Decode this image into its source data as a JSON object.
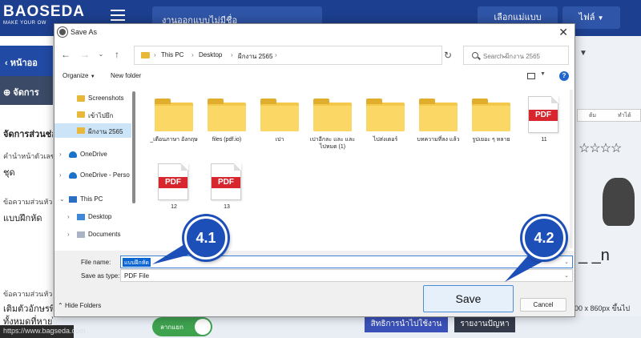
{
  "app": {
    "brand": "BAOSEDA",
    "tagline": "MAKE YOUR OW",
    "project_name": "งานออกแบบไม่มีชื่อ",
    "template_button": "เลือกแม่แบบ",
    "file_menu": "ไฟล์",
    "website": "https://www.bagseda.com"
  },
  "sidebar": {
    "back_label": "หน้าออ",
    "manage_label": "จัดการ",
    "section_label": "จัดการส่วนช่อ",
    "field1_label": "คำนำหน้าตัวเลข",
    "field1_value": "ชุด",
    "field2_label": "ข้อความส่วนหัว (1",
    "field2_value": "แบบฝึกหัด",
    "field3_label": "ข้อความส่วนหัว (2",
    "field3_value_line1": "เติมตัวอักษรพิ",
    "field3_value_line2": "ทั้งหมดที่หายไป"
  },
  "background": {
    "toggle_label": "ลากแยก",
    "rights_button": "สิทธิการนำไปใช้งาน",
    "report_button": "รายงานปัญหา",
    "col_head_1": "ต้ม",
    "col_head_2": "ทำได้",
    "stars": "☆☆☆☆",
    "blank_text": "_ _n",
    "size_note": "600 x 860px ขึ้นไป"
  },
  "dialog": {
    "title": "Save As",
    "breadcrumb": [
      "This PC",
      "Desktop",
      "ผีกงาน 2565"
    ],
    "search_placeholder": "Search ผีกงาน 2565",
    "organize": "Organize",
    "new_folder": "New folder",
    "help": "?",
    "nav_items": [
      {
        "label": "Screenshots",
        "icon": "folder-icon",
        "selected": false,
        "chevron": ""
      },
      {
        "label": "เข้าไปยึก",
        "icon": "folder-icon",
        "selected": false,
        "chevron": ""
      },
      {
        "label": "ผีกงาน 2565",
        "icon": "folder-icon",
        "selected": true,
        "chevron": ""
      },
      {
        "label": "OneDrive",
        "icon": "cloud-icon",
        "selected": false,
        "chevron": ">"
      },
      {
        "label": "OneDrive - Perso",
        "icon": "cloud-icon",
        "selected": false,
        "chevron": ">"
      },
      {
        "label": "This PC",
        "icon": "computer-icon",
        "selected": false,
        "chevron": "v"
      },
      {
        "label": "Desktop",
        "icon": "desktop-icon",
        "selected": false,
        "chevron": ">"
      },
      {
        "label": "Documents",
        "icon": "documents-icon",
        "selected": false,
        "chevron": ">"
      }
    ],
    "files": [
      {
        "name": "_เตือนภาษา อังกฤษ",
        "type": "folder"
      },
      {
        "name": "files (pdf.io)",
        "type": "folder"
      },
      {
        "name": "เปา",
        "type": "folder"
      },
      {
        "name": "เปาอีกละ และ และไปหมด (1)",
        "type": "folder"
      },
      {
        "name": "ไปส่งเตอร์",
        "type": "folder"
      },
      {
        "name": "บทความที่ลง แล้ว",
        "type": "folder"
      },
      {
        "name": "รูปเยอะ ๆ หลาย",
        "type": "folder"
      },
      {
        "name": "11",
        "type": "pdf"
      },
      {
        "name": "12",
        "type": "pdf"
      },
      {
        "name": "13",
        "type": "pdf"
      }
    ],
    "pdf_badge": "PDF",
    "file_name_label": "File name:",
    "file_name_value": "แบบฝึกหัด",
    "save_type_label": "Save as type:",
    "save_type_value": "PDF File",
    "hide_folders": "Hide Folders",
    "save_button": "Save",
    "cancel_button": "Cancel"
  },
  "callouts": {
    "step1": "4.1",
    "step2": "4.2",
    "color": "#1d4fb8"
  }
}
